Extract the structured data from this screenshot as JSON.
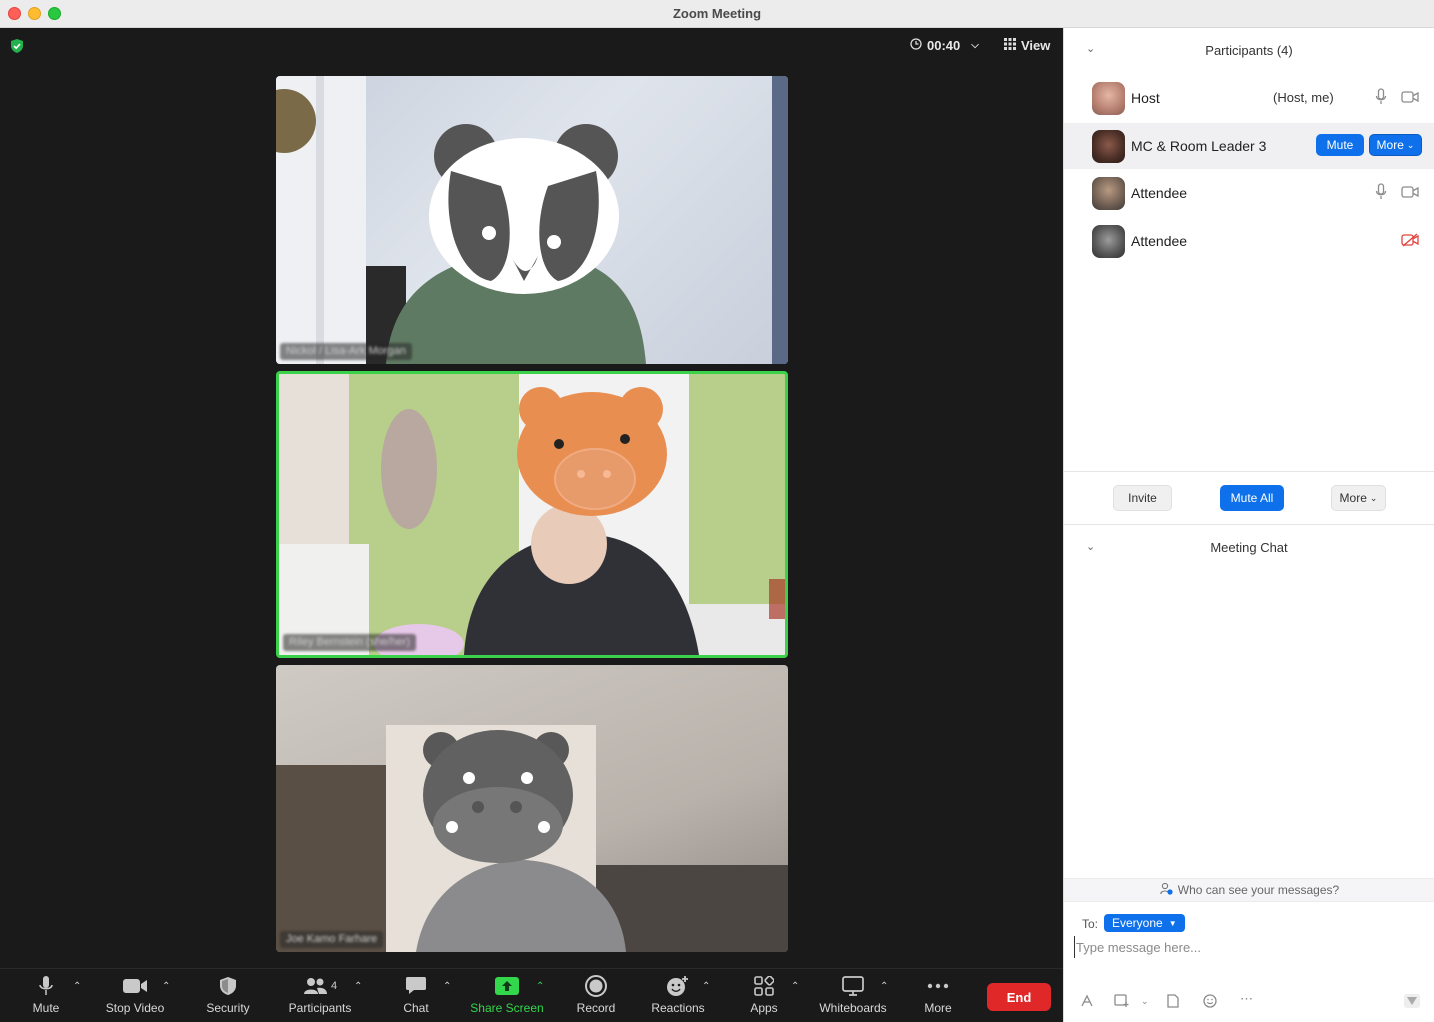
{
  "window": {
    "title": "Zoom Meeting"
  },
  "meeting": {
    "timer": "00:40",
    "view_label": "View"
  },
  "tiles": [
    {
      "name": "Nickol / Lisa-Ark Morgan",
      "mask": "badger"
    },
    {
      "name": "Riley Bernstein (she/her)",
      "mask": "pig"
    },
    {
      "name": "Joe Kamo Farhare",
      "mask": "hippo"
    }
  ],
  "toolbar": {
    "mute": "Mute",
    "stop_video": "Stop Video",
    "security": "Security",
    "participants": "Participants",
    "participants_count": "4",
    "chat": "Chat",
    "share_screen": "Share Screen",
    "record": "Record",
    "reactions": "Reactions",
    "apps": "Apps",
    "whiteboards": "Whiteboards",
    "more": "More",
    "end": "End"
  },
  "participants_panel": {
    "title": "Participants (4)",
    "rows": [
      {
        "name": "Host",
        "tag": "(Host, me)",
        "mic": "on",
        "video": "on"
      },
      {
        "name": "MC & Room Leader 3",
        "mute_label": "Mute",
        "more_label": "More"
      },
      {
        "name": "Attendee",
        "mic": "on",
        "video": "on"
      },
      {
        "name": "Attendee",
        "video": "off"
      }
    ],
    "invite": "Invite",
    "mute_all": "Mute All",
    "more": "More"
  },
  "chat_panel": {
    "title": "Meeting Chat",
    "who_can_see": "Who can see your messages?",
    "to_label": "To:",
    "to_value": "Everyone",
    "input_placeholder": "Type message here..."
  },
  "colors": {
    "accent": "#0e71eb",
    "end": "#e02828",
    "active_speaker": "#3bd14a",
    "share": "#32d74b",
    "video_off": "#e0443e"
  }
}
